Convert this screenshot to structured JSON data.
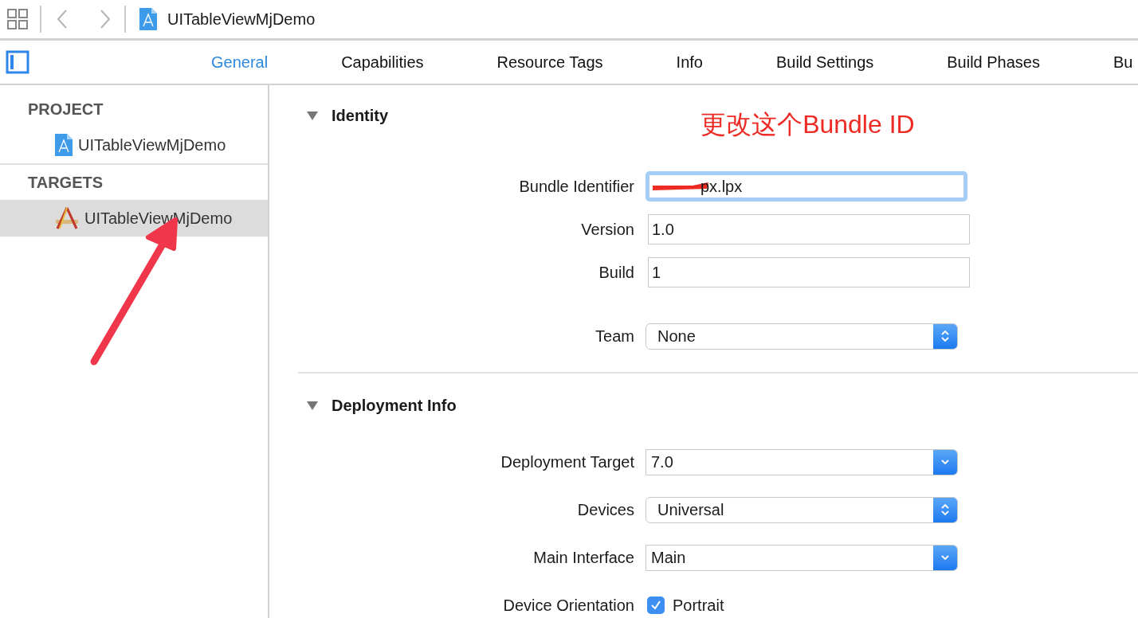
{
  "toolbar": {
    "title": "UITableViewMjDemo"
  },
  "tabs": [
    {
      "label": "General",
      "selected": true
    },
    {
      "label": "Capabilities",
      "selected": false
    },
    {
      "label": "Resource Tags",
      "selected": false
    },
    {
      "label": "Info",
      "selected": false
    },
    {
      "label": "Build Settings",
      "selected": false
    },
    {
      "label": "Build Phases",
      "selected": false
    },
    {
      "label": "Bu",
      "selected": false
    }
  ],
  "sidebar": {
    "groups": [
      {
        "heading": "PROJECT",
        "items": [
          {
            "label": "UITableViewMjDemo",
            "kind": "project",
            "selected": false
          }
        ]
      },
      {
        "heading": "TARGETS",
        "items": [
          {
            "label": "UITableViewMjDemo",
            "kind": "target",
            "selected": true
          }
        ]
      }
    ]
  },
  "sections": [
    {
      "title": "Identity",
      "expanded": true,
      "note": "更改这个Bundle ID",
      "rows": [
        {
          "label": "Bundle Identifier",
          "kind": "text",
          "value": "px.lpx",
          "focused": true,
          "redacted": true
        },
        {
          "label": "Version",
          "kind": "text",
          "value": "1.0",
          "focused": false,
          "redacted": false
        },
        {
          "label": "Build",
          "kind": "text",
          "value": "1",
          "focused": false,
          "redacted": false
        },
        {
          "label": "Team",
          "kind": "popup",
          "value": "None"
        }
      ]
    },
    {
      "title": "Deployment Info",
      "expanded": true,
      "rows": [
        {
          "label": "Deployment Target",
          "kind": "combo",
          "value": "7.0"
        },
        {
          "label": "Devices",
          "kind": "popup",
          "value": "Universal"
        },
        {
          "label": "Main Interface",
          "kind": "combo",
          "value": "Main"
        },
        {
          "label": "Device Orientation",
          "kind": "checkbox",
          "value": "Portrait",
          "checked": true
        }
      ]
    }
  ]
}
